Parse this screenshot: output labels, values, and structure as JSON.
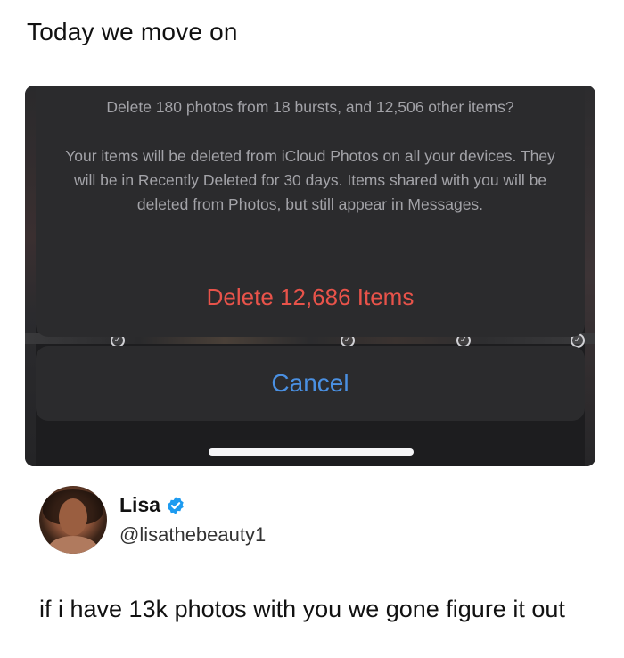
{
  "caption": "Today we move on",
  "dialog": {
    "title": "Delete 180 photos from 18 bursts, and 12,506 other items?",
    "message": "Your items will be deleted from iCloud Photos on all your devices. They will be in Recently Deleted for 30 days. Items shared with you will be deleted from Photos, but still appear in Messages.",
    "delete_label": "Delete 12,686 Items",
    "cancel_label": "Cancel"
  },
  "tweet": {
    "name": "Lisa",
    "handle": "@lisathebeauty1",
    "text": "if i have 13k photos with you we gone figure it out"
  },
  "colors": {
    "destructive": "#e8534a",
    "cancel": "#4a90e2",
    "verified": "#1d9bf0",
    "sheet": "#2b2b2d"
  },
  "icons": [
    "verified-badge-icon",
    "checkmark-icon"
  ]
}
